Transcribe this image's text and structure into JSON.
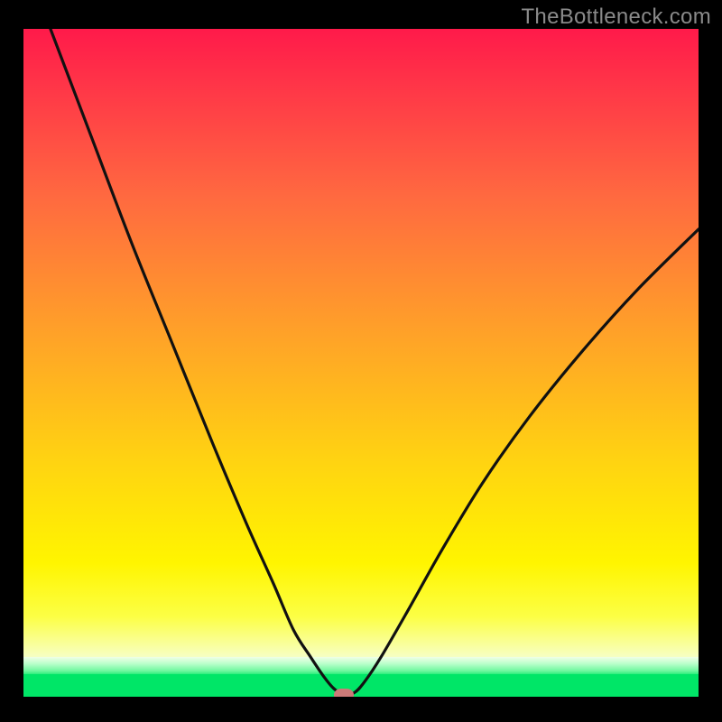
{
  "watermark": "TheBottleneck.com",
  "colors": {
    "frame": "#000000",
    "curve": "#111111",
    "marker": "#cc7a78",
    "green": "#00e667"
  },
  "chart_data": {
    "type": "line",
    "title": "",
    "xlabel": "",
    "ylabel": "",
    "xlim": [
      0,
      100
    ],
    "ylim": [
      0,
      100
    ],
    "grid": false,
    "series": [
      {
        "name": "bottleneck-curve",
        "x": [
          4,
          10,
          16,
          22,
          28,
          33,
          37,
          40,
          42.5,
          44.5,
          46,
          47.5,
          49,
          50.5,
          53,
          57,
          62,
          68,
          75,
          83,
          91,
          100
        ],
        "y": [
          100,
          84,
          68,
          53,
          38,
          26,
          17,
          10,
          6,
          3,
          1.2,
          0.3,
          0.6,
          2.2,
          6,
          13,
          22,
          32,
          42,
          52,
          61,
          70
        ]
      }
    ],
    "marker": {
      "x": 47.5,
      "y": 0.3
    },
    "note": "x,y in percent of plot area; y=0 bottom, y=100 top; values estimated from pixels"
  }
}
